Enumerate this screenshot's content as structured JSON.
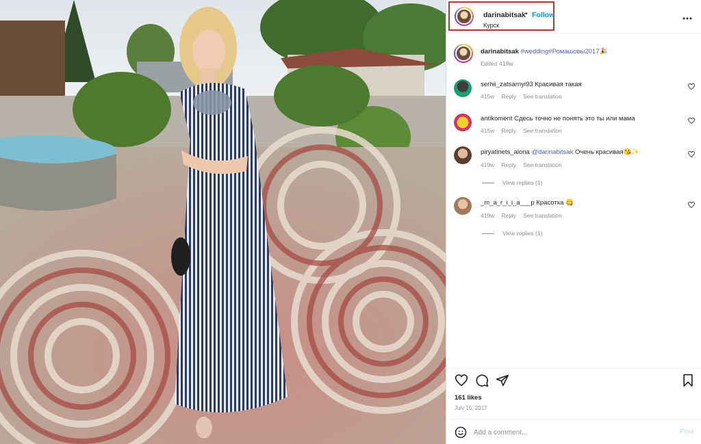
{
  "post": {
    "username": "darinabitsak",
    "separator": "•",
    "follow_label": "Follow",
    "location": "Курск",
    "more_icon": "more-horizontal-icon"
  },
  "caption": {
    "username": "darinabitsak",
    "hashtags": "#wedding#Ромашовы2017",
    "emoji": "🎉",
    "meta_edited": "Edited",
    "meta_time": "419w"
  },
  "comments": [
    {
      "username": "serhii_zatsarnyi93",
      "text": "Красивая такая",
      "time": "415w",
      "reply_label": "Reply",
      "translation_label": "See translation"
    },
    {
      "username": "antikoment",
      "text": "Сдесь точно не понять это ты или мама",
      "time": "415w",
      "reply_label": "Reply",
      "translation_label": "See translation"
    },
    {
      "username": "piryatinets_alona",
      "mention": "@darinabitsak",
      "text": "Очень красивая😘✨",
      "time": "419w",
      "reply_label": "Reply",
      "translation_label": "See translation",
      "view_replies": "View replies (1)"
    },
    {
      "username": "_m_a_r_i_i_a___p",
      "text": "Красотка 😋",
      "time": "419w",
      "reply_label": "Reply",
      "translation_label": "See translation",
      "view_replies": "View replies (1)"
    }
  ],
  "actions": {
    "like_icon": "heart-icon",
    "comment_icon": "comment-icon",
    "share_icon": "share-icon",
    "save_icon": "bookmark-icon",
    "likes": "161 likes",
    "date": "July 15, 2017"
  },
  "add_comment": {
    "emoji_icon": "emoji-icon",
    "placeholder": "Add a comment...",
    "post_label": "Post"
  },
  "colors": {
    "accent_blue": "#0095f6",
    "hashtag": "#4f5bd5",
    "highlight_box": "#b03a2e",
    "muted_text": "#8e8e8e"
  }
}
